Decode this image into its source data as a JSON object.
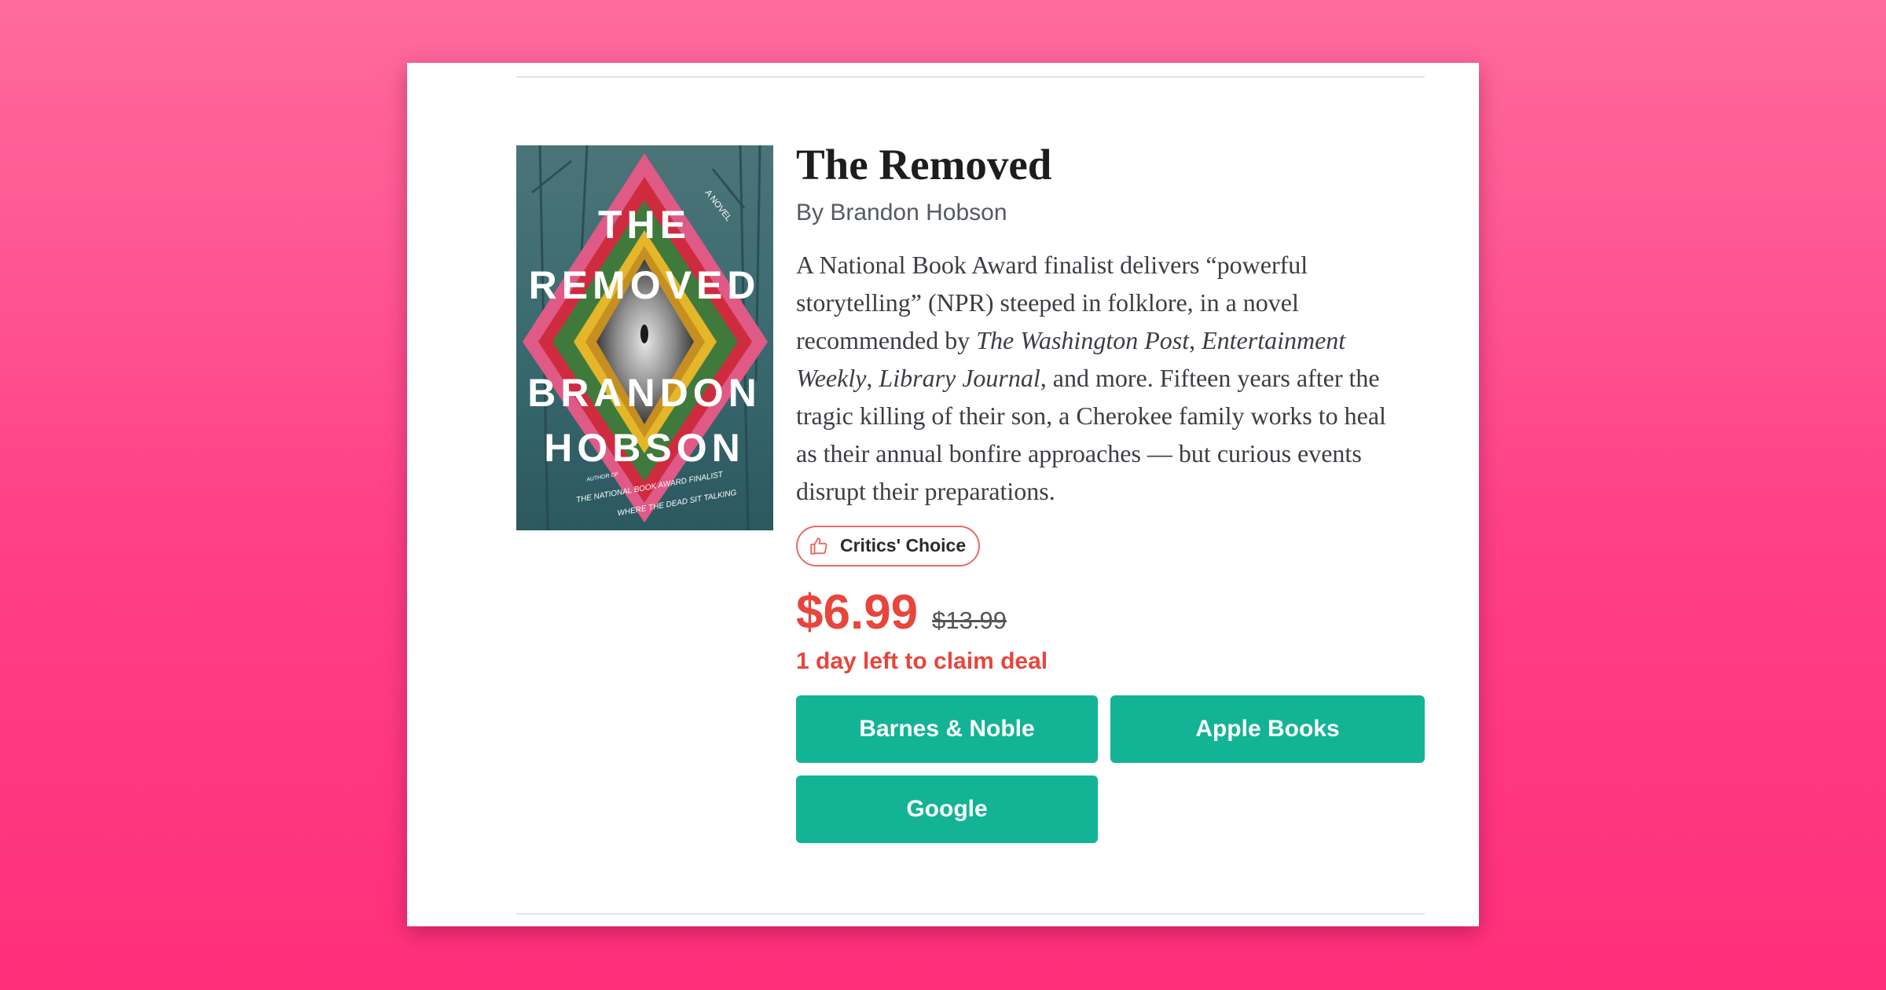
{
  "book": {
    "title": "The Removed",
    "author": "By Brandon Hobson",
    "description": {
      "p1": "A National Book Award finalist delivers “powerful storytelling” (NPR) steeped in folklore, in a novel recommended by ",
      "pub1": "The Washington Post",
      "sep1": ", ",
      "pub2": "Entertainment Weekly",
      "sep2": ", ",
      "pub3": "Library Journal",
      "p2": ", and more. Fifteen years after the tragic killing of their son, a Cherokee family works to heal as their annual bonfire approaches — but curious events disrupt their preparations."
    },
    "cover": {
      "top_label": "A NOVEL",
      "title_line1": "THE",
      "title_line2": "REMOVED",
      "author_line1": "BRANDON",
      "author_line2": "HOBSON",
      "tagline_line1": "AUTHOR OF",
      "tagline_line2": "THE NATIONAL BOOK AWARD FINALIST",
      "tagline_line3": "WHERE THE DEAD SIT TALKING"
    }
  },
  "badge": {
    "label": "Critics' Choice",
    "icon": "thumbs-up-icon"
  },
  "pricing": {
    "sale_price": "$6.99",
    "original_price": "$13.99",
    "deal_text": "1 day left to claim deal"
  },
  "retailers": [
    {
      "label": "Barnes & Noble"
    },
    {
      "label": "Apple Books"
    },
    {
      "label": "Google"
    }
  ],
  "colors": {
    "accent_red": "#e8453c",
    "button_green": "#12b495",
    "background_pink": "#ff3f86"
  }
}
